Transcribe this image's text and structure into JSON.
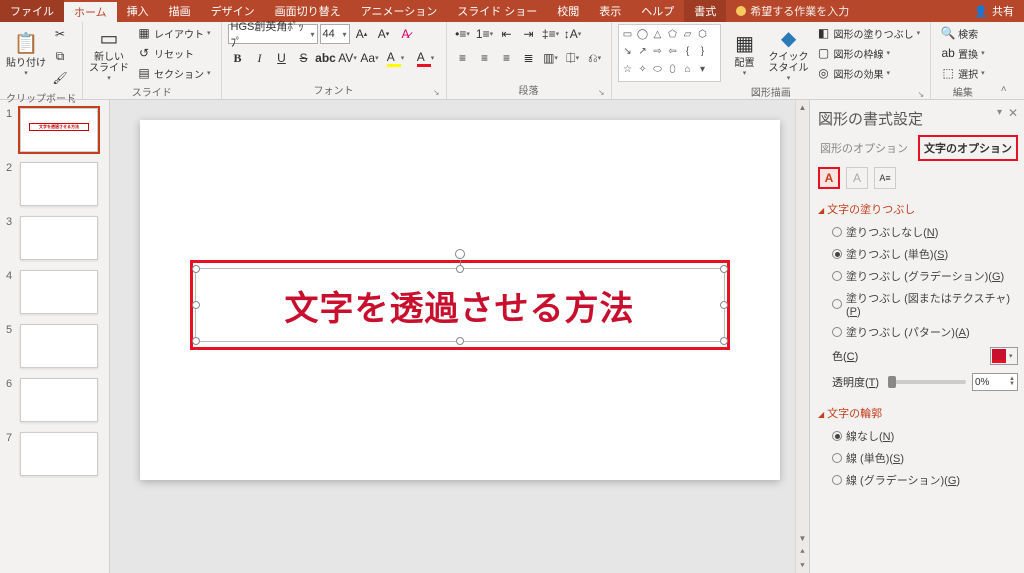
{
  "titlebar": {
    "tabs": [
      "ファイル",
      "ホーム",
      "挿入",
      "描画",
      "デザイン",
      "画面切り替え",
      "アニメーション",
      "スライド ショー",
      "校閲",
      "表示",
      "ヘルプ",
      "書式"
    ],
    "active_tab": 1,
    "format_tab": 11,
    "tell_me": "希望する作業を入力",
    "share": "共有"
  },
  "ribbon": {
    "clipboard": {
      "paste": "貼り付け",
      "label": "クリップボード"
    },
    "slides": {
      "new_slide": "新しい\nスライド",
      "layout": "レイアウト",
      "reset": "リセット",
      "section": "セクション",
      "label": "スライド"
    },
    "font": {
      "name": "HGS創英角ﾎﾟｯﾌﾟ",
      "size": "44",
      "label": "フォント"
    },
    "paragraph": {
      "label": "段落"
    },
    "drawing": {
      "arrange": "配置",
      "quick_styles": "クイック\nスタイル",
      "shape_fill": "図形の塗りつぶし",
      "shape_outline": "図形の枠線",
      "shape_effects": "図形の効果",
      "label": "図形描画"
    },
    "editing": {
      "find": "検索",
      "replace": "置換",
      "select": "選択",
      "label": "編集"
    }
  },
  "thumbs": [
    "1",
    "2",
    "3",
    "4",
    "5",
    "6",
    "7"
  ],
  "slide_text": "文字を透過させる方法",
  "pane": {
    "title": "図形の書式設定",
    "tab_shape": "図形のオプション",
    "tab_text": "文字のオプション",
    "sect_fill": "文字の塗りつぶし",
    "fill_none": "塗りつぶしなし(",
    "fill_none_k": "N",
    "fill_solid": "塗りつぶし (単色)(",
    "fill_solid_k": "S",
    "fill_grad": "塗りつぶし (グラデーション)(",
    "fill_grad_k": "G",
    "fill_pict": "塗りつぶし (図またはテクスチャ)(",
    "fill_pict_k": "P",
    "fill_patt": "塗りつぶし (パターン)(",
    "fill_patt_k": "A",
    "color_label": "色(",
    "color_k": "C",
    "trans_label": "透明度(",
    "trans_k": "T",
    "trans_value": "0%",
    "sect_outline": "文字の輪郭",
    "line_none": "線なし(",
    "line_none_k": "N",
    "line_solid": "線 (単色)(",
    "line_solid_k": "S",
    "line_grad": "線 (グラデーション)(",
    "line_grad_k": "G"
  }
}
